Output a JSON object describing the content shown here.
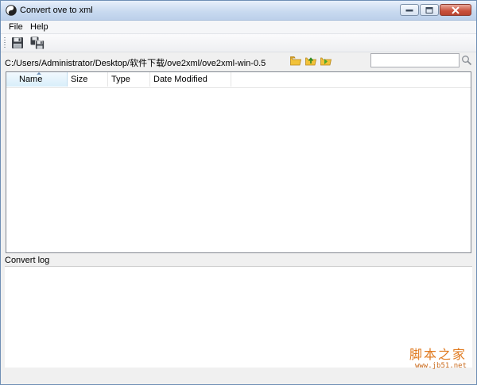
{
  "window": {
    "title": "Convert ove to xml"
  },
  "menu": {
    "items": [
      "File",
      "Help"
    ]
  },
  "toolbar": {
    "buttons": [
      {
        "icon": "save-icon"
      },
      {
        "icon": "save-all-icon"
      }
    ]
  },
  "path": {
    "current": "C:/Users/Administrator/Desktop/软件下载/ove2xml/ove2xml-win-0.5"
  },
  "search": {
    "value": "",
    "placeholder": ""
  },
  "file_list": {
    "columns": [
      "Name",
      "Size",
      "Type",
      "Date Modified"
    ],
    "sorted_column": "Name",
    "rows": []
  },
  "log": {
    "label": "Convert log",
    "lines": []
  },
  "watermark": {
    "text": "脚本之家",
    "url": "www.jb51.net"
  },
  "colors": {
    "titlebar": "#c9daf0",
    "close_button": "#c9503c",
    "folder_yellow": "#f2c23a",
    "folder_green": "#4ea72e",
    "watermark": "#e07a1f"
  }
}
